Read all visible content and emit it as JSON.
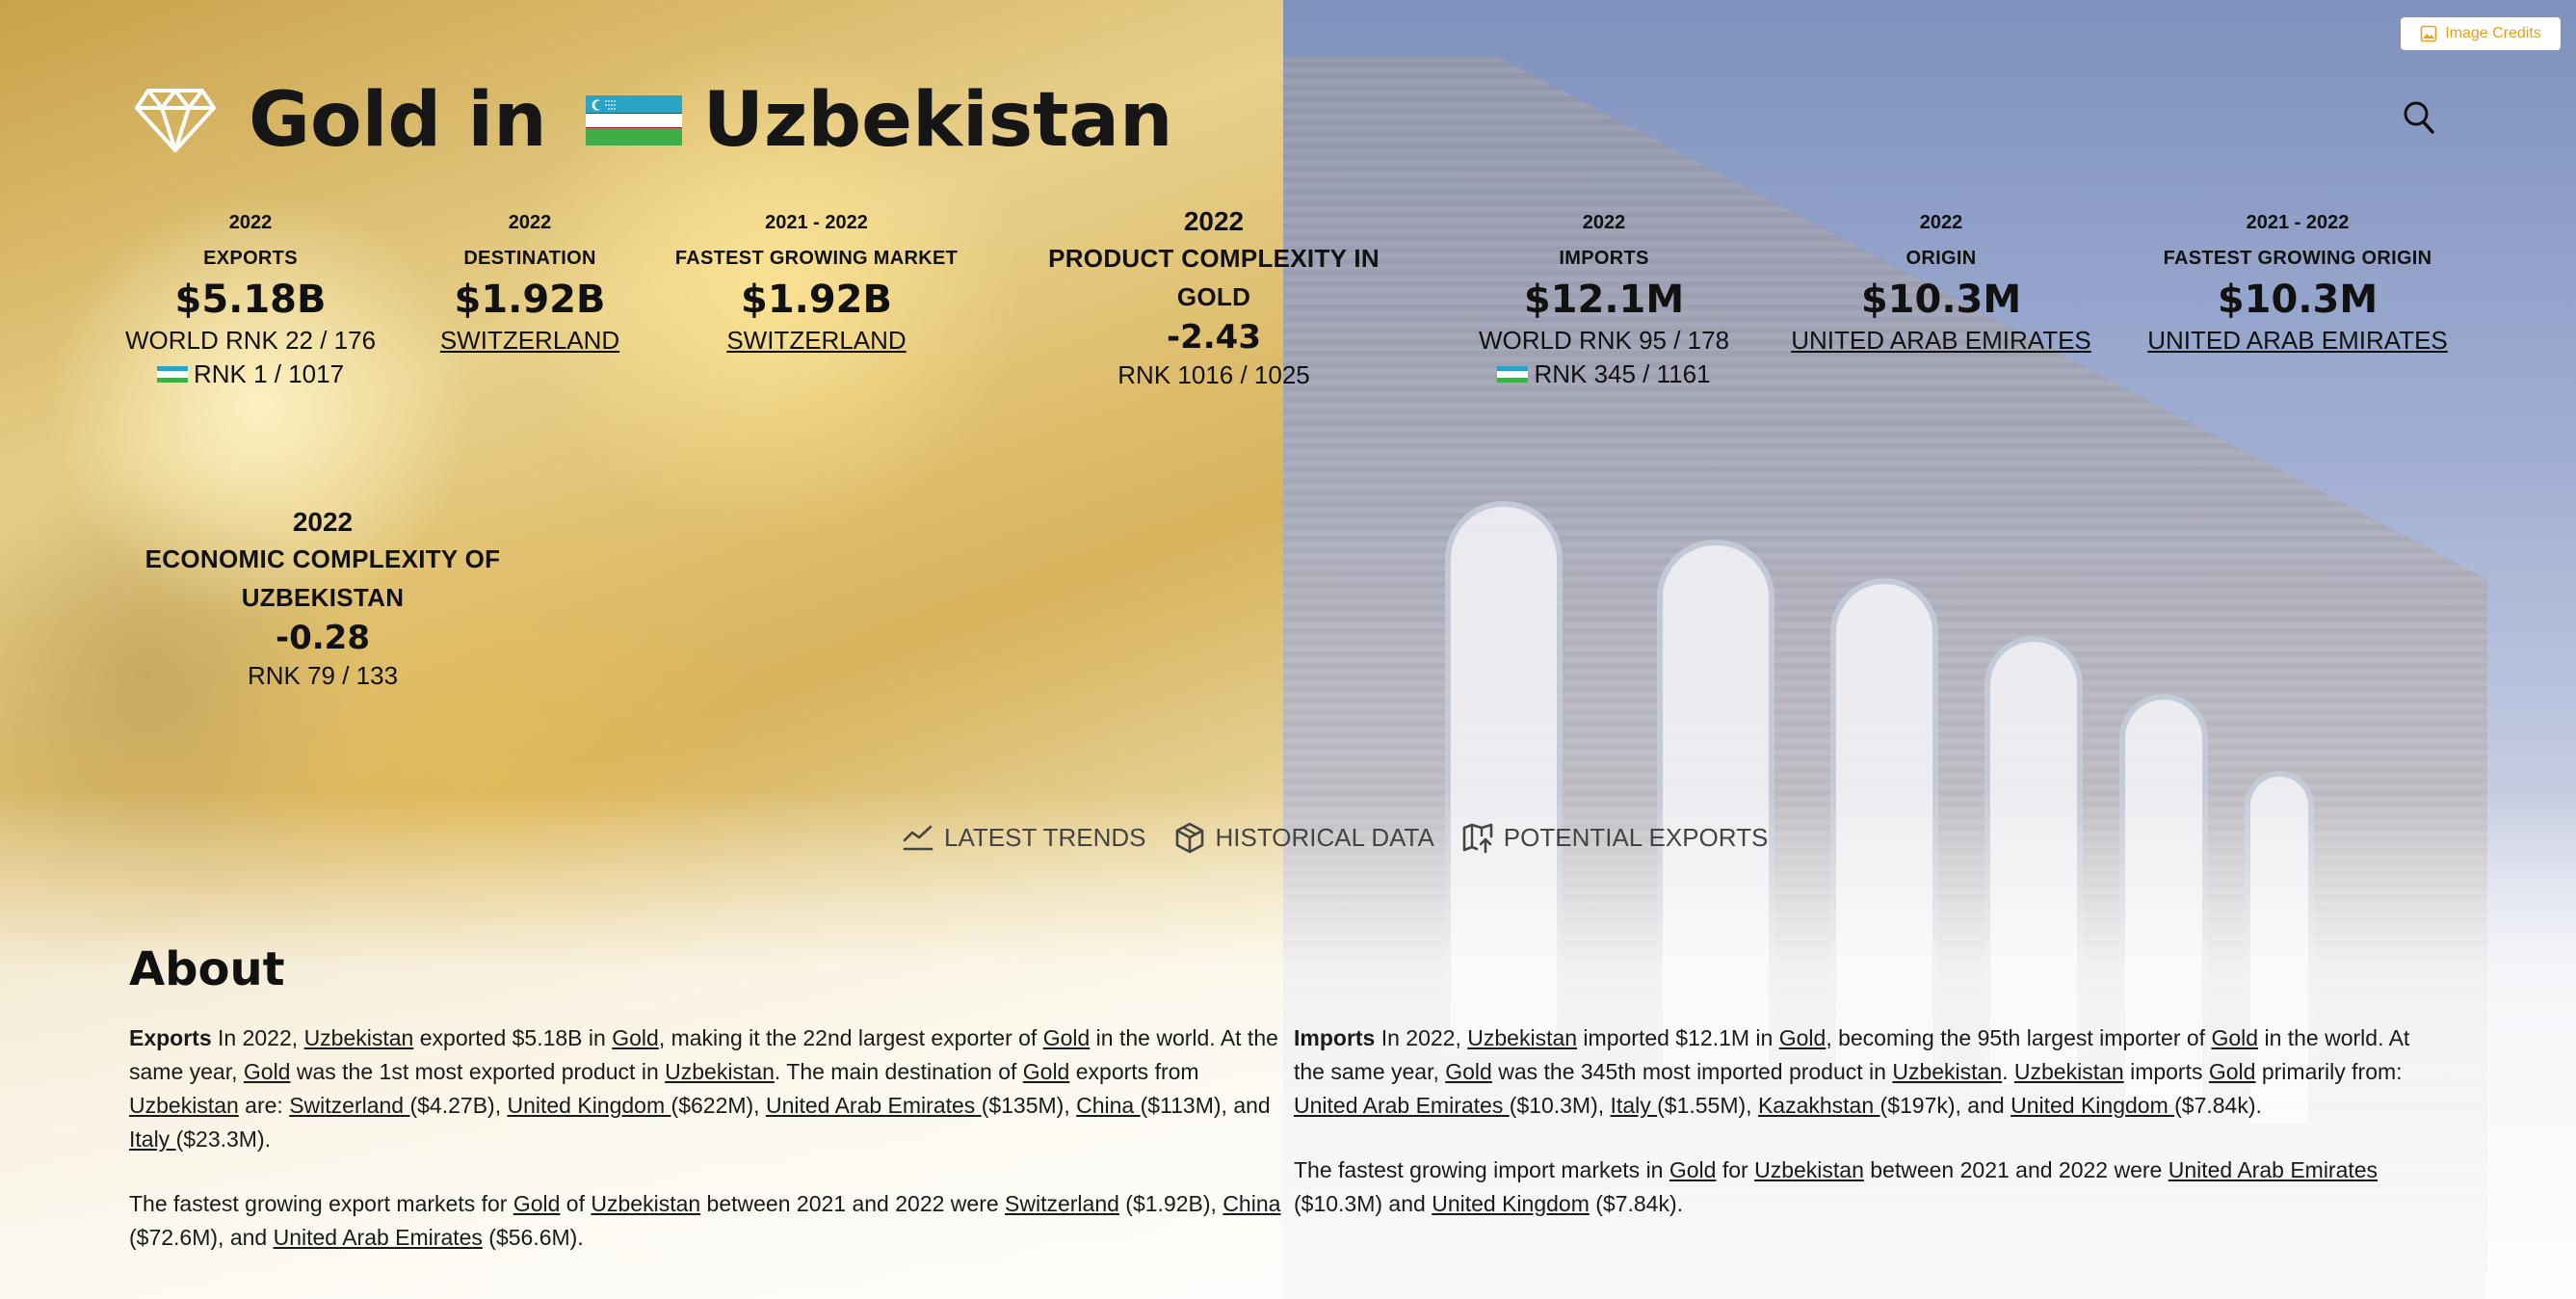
{
  "header": {
    "title_prefix": "Gold in",
    "country": "Uzbekistan",
    "image_credits": "Image Credits"
  },
  "stats": {
    "exports": {
      "year": "2022",
      "label": "EXPORTS",
      "value": "$5.18B",
      "world_rank": "WORLD RNK 22 / 176",
      "country_rank": "RNK 1 / 1017"
    },
    "destination": {
      "year": "2022",
      "label": "DESTINATION",
      "value": "$1.92B",
      "link": "SWITZERLAND"
    },
    "fastest_market": {
      "year": "2021 - 2022",
      "label": "FASTEST GROWING MARKET",
      "value": "$1.92B",
      "link": "SWITZERLAND"
    },
    "product_complexity": {
      "year": "2022",
      "label_line1": "PRODUCT COMPLEXITY IN",
      "label_line2": "GOLD",
      "value": "-2.43",
      "rank": "RNK 1016 / 1025"
    },
    "imports": {
      "year": "2022",
      "label": "IMPORTS",
      "value": "$12.1M",
      "world_rank": "WORLD RNK 95 / 178",
      "country_rank": "RNK 345 / 1161"
    },
    "origin": {
      "year": "2022",
      "label": "ORIGIN",
      "value": "$10.3M",
      "link": "UNITED ARAB EMIRATES"
    },
    "fastest_origin": {
      "year": "2021 - 2022",
      "label": "FASTEST GROWING ORIGIN",
      "value": "$10.3M",
      "link": "UNITED ARAB EMIRATES"
    },
    "economic_complexity": {
      "year": "2022",
      "label_line1": "ECONOMIC COMPLEXITY OF",
      "label_line2": "UZBEKISTAN",
      "value": "-0.28",
      "rank": "RNK 79 / 133"
    }
  },
  "tabs": [
    {
      "label": "LATEST TRENDS",
      "icon": "trend-line-icon"
    },
    {
      "label": "HISTORICAL DATA",
      "icon": "cube-icon"
    },
    {
      "label": "POTENTIAL EXPORTS",
      "icon": "map-arrow-icon"
    }
  ],
  "about": {
    "title": "About",
    "exports": {
      "heading": "Exports",
      "t1": " In 2022, ",
      "country1": "Uzbekistan",
      "t2": " exported $5.18B in ",
      "product1": "Gold",
      "t3": ", making it the 22nd largest exporter of ",
      "product2": "Gold",
      "t4": " in the world. At the same year, ",
      "product3": "Gold",
      "t5": " was the 1st most exported product in ",
      "country2": "Uzbekistan",
      "t6": ". The main destination of ",
      "product4": "Gold",
      "t7": " exports from ",
      "country3": "Uzbekistan",
      "t8": " are: ",
      "d1": "Switzerland ",
      "d1v": "($4.27B), ",
      "d2": "United Kingdom ",
      "d2v": "($622M), ",
      "d3": "United Arab Emirates ",
      "d3v": "($135M), ",
      "d4": "China ",
      "d4v": "($113M), and ",
      "d5": "Italy ",
      "d5v": "($23.3M).",
      "g1": "The fastest growing export markets for ",
      "gp": "Gold",
      "g2": " of ",
      "gc": "Uzbekistan",
      "g3": " between 2021 and 2022 were ",
      "gm1": "Switzerland",
      "gm1v": " ($1.92B), ",
      "gm2": "China",
      "gm2v": " ($72.6M), and ",
      "gm3": "United Arab Emirates",
      "gm3v": " ($56.6M)."
    },
    "imports": {
      "heading": "Imports",
      "t1": " In 2022, ",
      "country1": "Uzbekistan",
      "t2": " imported $12.1M in ",
      "product1": "Gold",
      "t3": ", becoming the 95th largest importer of ",
      "product2": "Gold",
      "t4": " in the world. At the same year, ",
      "product3": "Gold",
      "t5": " was the 345th most imported product in ",
      "country2": "Uzbekistan",
      "t6": ". ",
      "country3": "Uzbekistan",
      "t7": " imports ",
      "product4": "Gold",
      "t8": " primarily from: ",
      "o1": "United Arab Emirates ",
      "o1v": "($10.3M), ",
      "o2": "Italy ",
      "o2v": "($1.55M), ",
      "o3": "Kazakhstan ",
      "o3v": "($197k), and ",
      "o4": "United Kingdom ",
      "o4v": "($7.84k).",
      "g1": "The fastest growing import markets in ",
      "gp": "Gold",
      "g2": " for ",
      "gc": "Uzbekistan",
      "g3": " between 2021 and 2022 were ",
      "gm1": "United Arab Emirates",
      "gm1v": " ($10.3M) and ",
      "gm2": "United Kingdom",
      "gm2v": " ($7.84k)."
    }
  },
  "colors": {
    "accent": "#e8a21a",
    "flag_blue": "#2aa4c4",
    "flag_green": "#3fae49",
    "flag_red": "#c8102e"
  }
}
